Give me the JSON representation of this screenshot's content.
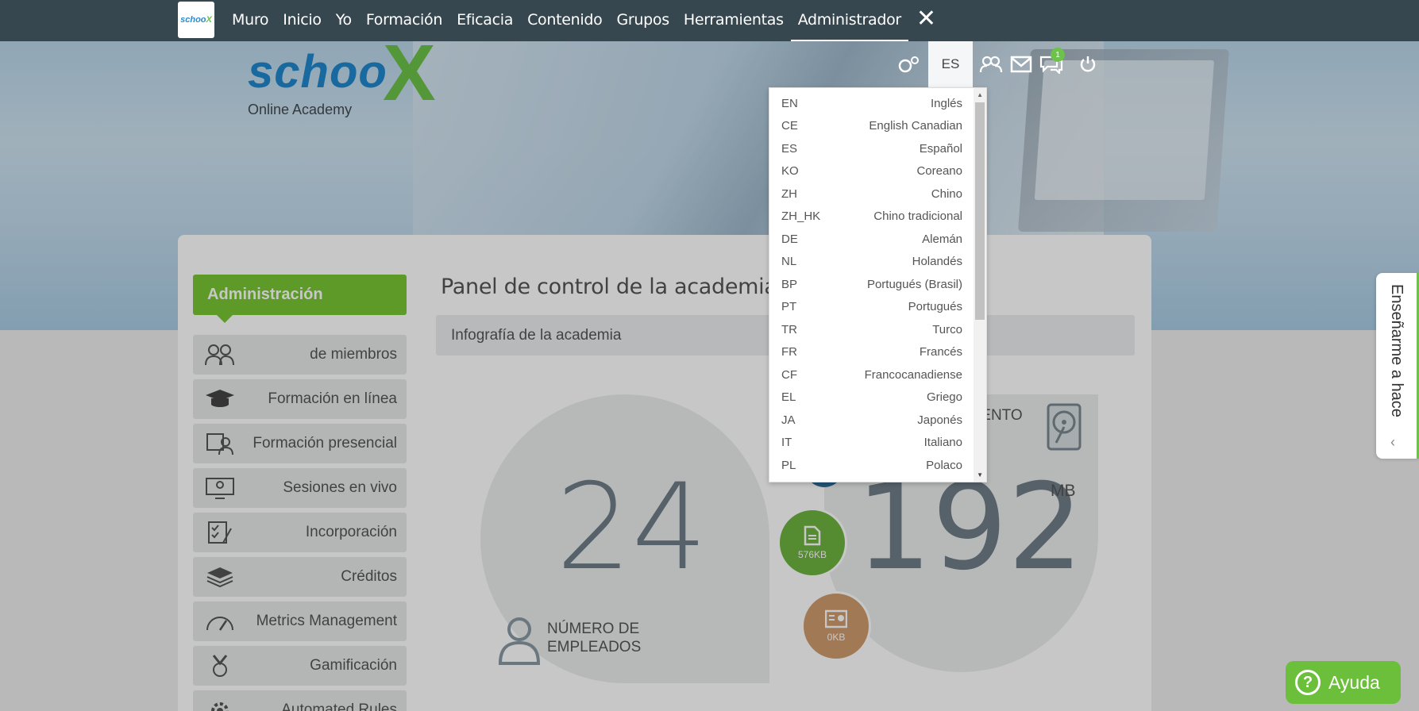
{
  "topnav": {
    "logo_text": "schoo",
    "logo_x": "X",
    "items": [
      "Muro",
      "Inicio",
      "Yo",
      "Formación",
      "Eficacia",
      "Contenido",
      "Grupos",
      "Herramientas",
      "Administrador"
    ],
    "active": "Administrador",
    "close_symbol": "✕"
  },
  "brand": {
    "word": "schoo",
    "x": "X",
    "subtitle": "Online Academy"
  },
  "header": {
    "lang": "ES",
    "badge": "1"
  },
  "language_dropdown": {
    "options": [
      {
        "code": "EN",
        "name": "Inglés"
      },
      {
        "code": "CE",
        "name": "English Canadian"
      },
      {
        "code": "ES",
        "name": "Español"
      },
      {
        "code": "KO",
        "name": "Coreano"
      },
      {
        "code": "ZH",
        "name": "Chino"
      },
      {
        "code": "ZH_HK",
        "name": "Chino tradicional"
      },
      {
        "code": "DE",
        "name": "Alemán"
      },
      {
        "code": "NL",
        "name": "Holandés"
      },
      {
        "code": "BP",
        "name": "Portugués (Brasil)"
      },
      {
        "code": "PT",
        "name": "Portugués"
      },
      {
        "code": "TR",
        "name": "Turco"
      },
      {
        "code": "FR",
        "name": "Francés"
      },
      {
        "code": "CF",
        "name": "Francocanadiense"
      },
      {
        "code": "EL",
        "name": "Griego"
      },
      {
        "code": "JA",
        "name": "Japonés"
      },
      {
        "code": "IT",
        "name": "Italiano"
      },
      {
        "code": "PL",
        "name": "Polaco"
      }
    ]
  },
  "sidebar": {
    "title": "Administración",
    "items": [
      {
        "label": "de miembros",
        "icon": "members-icon"
      },
      {
        "label": "Formación en línea",
        "icon": "graduation-cap-icon"
      },
      {
        "label": "Formación presencial",
        "icon": "classroom-icon"
      },
      {
        "label": "Sesiones en vivo",
        "icon": "live-session-icon"
      },
      {
        "label": "Incorporación",
        "icon": "checklist-icon"
      },
      {
        "label": "Créditos",
        "icon": "layers-icon"
      },
      {
        "label": "Metrics Management",
        "icon": "gauge-icon"
      },
      {
        "label": "Gamificación",
        "icon": "medal-icon"
      },
      {
        "label": "Automated Rules",
        "icon": "gear-icon"
      }
    ]
  },
  "main": {
    "title": "Panel de control de la academia",
    "infobar": "Infografía de la academia",
    "employees_value": "24",
    "employees_label_1": "NÚMERO DE",
    "employees_label_2": "EMPLEADOS",
    "storage_value": "192",
    "storage_unit": "MB",
    "storage_label": "IENTO",
    "doc_size": "576KB",
    "media_size": "0KB"
  },
  "side_tab": {
    "label": "Enseñarme a hace"
  },
  "help": {
    "label": "Ayuda"
  },
  "colors": {
    "nav_bg": "#37474f",
    "accent_green": "#78c634",
    "brand_blue": "#1f87cc",
    "storage_brown": "#cf9c6e"
  }
}
